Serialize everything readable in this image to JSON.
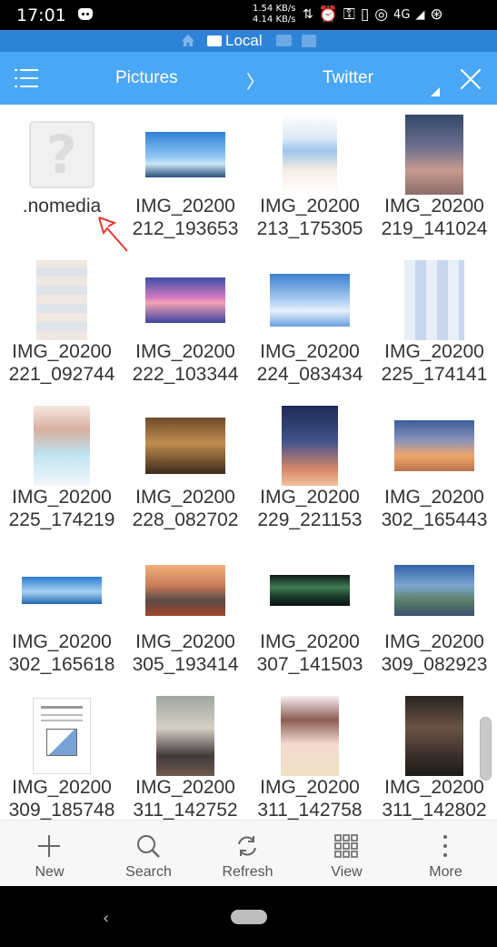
{
  "status_bar": {
    "time": "17:01",
    "speed_up": "1.54 KB/s",
    "speed_down": "4.14 KB/s",
    "network": "4G"
  },
  "location_bar": {
    "label": "Local"
  },
  "toolbar": {
    "crumb_parent": "Pictures",
    "crumb_sep": "〉",
    "crumb_current": "Twitter"
  },
  "files": [
    {
      "line1": ".nomedia",
      "line2": "",
      "thumb": "unknown"
    },
    {
      "line1": "IMG_20200",
      "line2": "212_193653",
      "thumb": "sky-wide"
    },
    {
      "line1": "IMG_20200",
      "line2": "213_175305",
      "thumb": "anime-bluehair"
    },
    {
      "line1": "IMG_20200",
      "line2": "219_141024",
      "thumb": "redhair-dusk"
    },
    {
      "line1": "IMG_20200",
      "line2": "221_092744",
      "thumb": "pixelated-pale"
    },
    {
      "line1": "IMG_20200",
      "line2": "222_103344",
      "thumb": "tree-reflection-sunset"
    },
    {
      "line1": "IMG_20200",
      "line2": "224_083434",
      "thumb": "clouds-sky"
    },
    {
      "line1": "IMG_20200",
      "line2": "225_174141",
      "thumb": "pixelated-blue"
    },
    {
      "line1": "IMG_20200",
      "line2": "225_174219",
      "thumb": "anime-girl-flowers"
    },
    {
      "line1": "IMG_20200",
      "line2": "228_082702",
      "thumb": "classroom-sunset"
    },
    {
      "line1": "IMG_20200",
      "line2": "229_221153",
      "thumb": "starry-night-figure"
    },
    {
      "line1": "IMG_20200",
      "line2": "302_165443",
      "thumb": "powerlines-sunset"
    },
    {
      "line1": "IMG_20200",
      "line2": "302_165618",
      "thumb": "ocean-panorama"
    },
    {
      "line1": "IMG_20200",
      "line2": "305_193414",
      "thumb": "two-girls-sunset"
    },
    {
      "line1": "IMG_20200",
      "line2": "307_141503",
      "thumb": "aurora-night"
    },
    {
      "line1": "IMG_20200",
      "line2": "309_082923",
      "thumb": "street-alley"
    },
    {
      "line1": "IMG_20200",
      "line2": "309_185748",
      "thumb": "document-page"
    },
    {
      "line1": "IMG_20200",
      "line2": "311_142752",
      "thumb": "schoolgirl-street"
    },
    {
      "line1": "IMG_20200",
      "line2": "311_142758",
      "thumb": "anime-girl-pink"
    },
    {
      "line1": "IMG_20200",
      "line2": "311_142802",
      "thumb": "girl-sitting-dark"
    }
  ],
  "unknown_glyph": "?",
  "actions": [
    {
      "label": "New",
      "icon": "plus-icon"
    },
    {
      "label": "Search",
      "icon": "search-icon"
    },
    {
      "label": "Refresh",
      "icon": "refresh-icon"
    },
    {
      "label": "View",
      "icon": "grid-view-icon"
    },
    {
      "label": "More",
      "icon": "more-vertical-icon"
    }
  ],
  "nav": {
    "back_glyph": "‹"
  },
  "colors": {
    "toolbar": "#4aa7f5",
    "location_bar": "#2e83d7",
    "annotation_arrow": "#e53935"
  }
}
